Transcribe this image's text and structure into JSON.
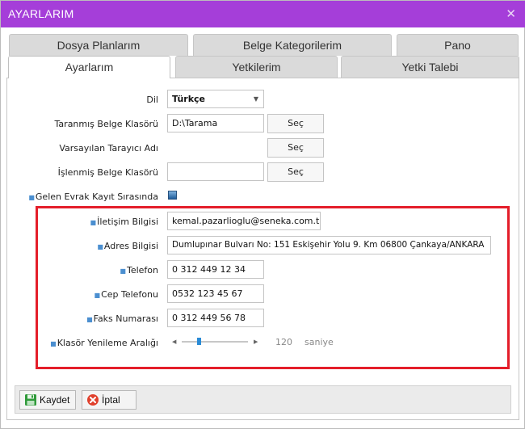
{
  "window": {
    "title": "AYARLARIM",
    "close_glyph": "✕"
  },
  "tabs_row1": [
    {
      "label": "Dosya Planlarım"
    },
    {
      "label": "Belge Kategorilerim"
    },
    {
      "label": "Pano"
    }
  ],
  "tabs_row2": [
    {
      "label": "Ayarlarım",
      "active": true
    },
    {
      "label": "Yetkilerim"
    },
    {
      "label": "Yetki Talebi"
    }
  ],
  "form": {
    "language": {
      "label": "Dil",
      "value": "Türkçe"
    },
    "scanned_folder": {
      "label": "Taranmış Belge Klasörü",
      "value": "D:\\Tarama",
      "button": "Seç"
    },
    "default_scanner": {
      "label": "Varsayılan Tarayıcı Adı",
      "button": "Seç"
    },
    "processed_folder": {
      "label": "İşlenmiş Belge Klasörü",
      "value": "",
      "button": "Seç"
    },
    "incoming_order": {
      "label": "Gelen Evrak Kayıt Sırasında",
      "checked": true
    },
    "contact": {
      "label": "İletişim Bilgisi",
      "value": "kemal.pazarlioglu@seneka.com.tr"
    },
    "address": {
      "label": "Adres Bilgisi",
      "value": "Dumlupınar Bulvarı No: 151 Eskişehir Yolu 9. Km 06800 Çankaya/ANKARA"
    },
    "phone": {
      "label": "Telefon",
      "value": "0 312 449 12 34"
    },
    "mobile": {
      "label": "Cep Telefonu",
      "value": "0532 123 45 67"
    },
    "fax": {
      "label": "Faks Numarası",
      "value": "0 312 449 56 78"
    },
    "refresh": {
      "label": "Klasör Yenileme Aralığı",
      "value": "120",
      "unit": "saniye",
      "slider_fraction": 0.25
    }
  },
  "actions": {
    "save": "Kaydet",
    "cancel": "İptal"
  },
  "colors": {
    "titlebar": "#a53ed9",
    "highlight": "#e41e2a",
    "accent": "#2a8bd6"
  },
  "icons": {
    "save": "floppy-disk-icon",
    "cancel": "cancel-circle-icon",
    "bullet": "bullet-icon"
  }
}
